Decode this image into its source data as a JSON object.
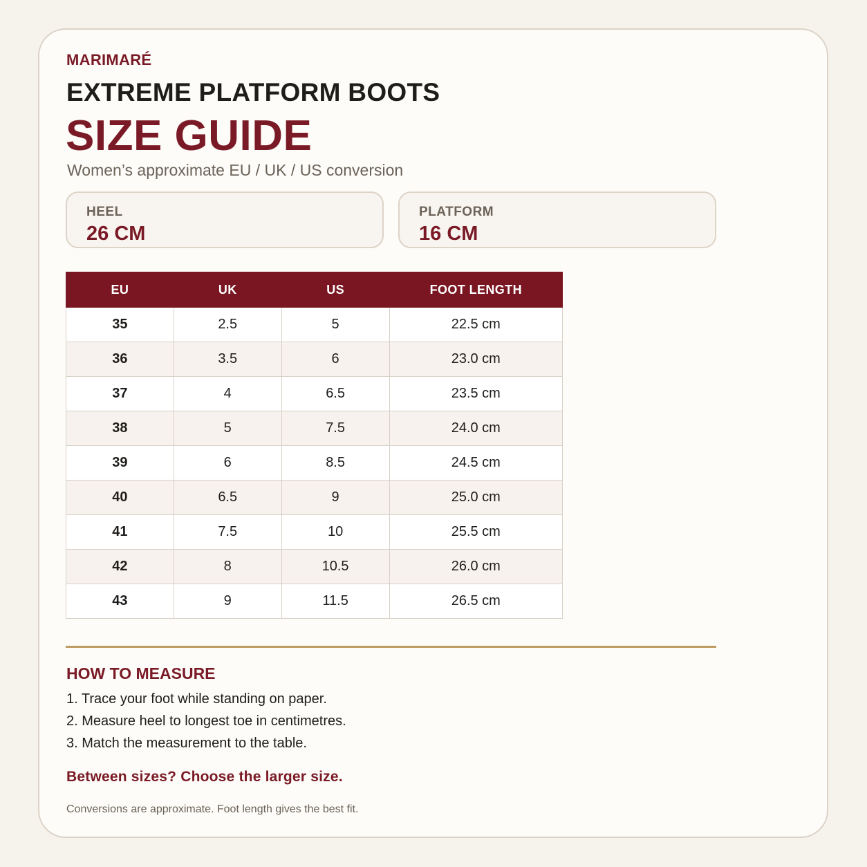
{
  "brand": "MARIMARÉ",
  "product_name": "EXTREME PLATFORM BOOTS",
  "title": "SIZE GUIDE",
  "subtitle": "Women’s approximate EU / UK / US conversion",
  "specs": [
    {
      "label": "HEEL",
      "value": "26 CM"
    },
    {
      "label": "PLATFORM",
      "value": "16 CM"
    }
  ],
  "table": {
    "headers": [
      "EU",
      "UK",
      "US",
      "FOOT LENGTH"
    ],
    "rows": [
      [
        "35",
        "2.5",
        "5",
        "22.5 cm"
      ],
      [
        "36",
        "3.5",
        "6",
        "23.0 cm"
      ],
      [
        "37",
        "4",
        "6.5",
        "23.5 cm"
      ],
      [
        "38",
        "5",
        "7.5",
        "24.0 cm"
      ],
      [
        "39",
        "6",
        "8.5",
        "24.5 cm"
      ],
      [
        "40",
        "6.5",
        "9",
        "25.0 cm"
      ],
      [
        "41",
        "7.5",
        "10",
        "25.5 cm"
      ],
      [
        "42",
        "8",
        "10.5",
        "26.0 cm"
      ],
      [
        "43",
        "9",
        "11.5",
        "26.5 cm"
      ]
    ]
  },
  "how_to_measure": {
    "title": "HOW TO MEASURE",
    "steps": [
      "1. Trace your foot while standing on paper.",
      "2. Measure heel to longest toe in centimetres.",
      "3. Match the measurement to the table."
    ]
  },
  "tip": "Between sizes? Choose the larger size.",
  "note": "Conversions are approximate. Foot length gives the best fit.",
  "colors": {
    "accent": "#7a1a26",
    "header_bg": "#7a1622",
    "divider": "#bf9c62",
    "page_bg": "#f6f2ec",
    "card_bg": "#fdfcf8"
  }
}
